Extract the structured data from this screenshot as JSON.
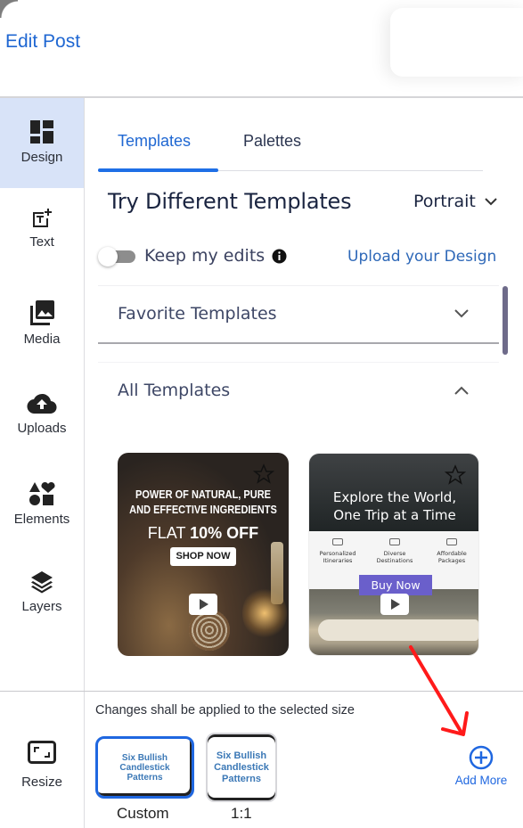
{
  "header": {
    "title": "Edit Post"
  },
  "sidebar": {
    "items": [
      {
        "label": "Design",
        "icon": "design-grid-icon",
        "active": true
      },
      {
        "label": "Text",
        "icon": "text-add-icon"
      },
      {
        "label": "Media",
        "icon": "media-icon"
      },
      {
        "label": "Uploads",
        "icon": "cloud-upload-icon"
      },
      {
        "label": "Elements",
        "icon": "shapes-icon"
      },
      {
        "label": "Layers",
        "icon": "layers-icon"
      }
    ],
    "resize": {
      "label": "Resize",
      "icon": "resize-icon"
    }
  },
  "tabs": [
    {
      "label": "Templates",
      "active": true
    },
    {
      "label": "Palettes",
      "active": false
    }
  ],
  "templates_panel": {
    "title": "Try Different Templates",
    "orientation": "Portrait",
    "keep_edits": {
      "label": "Keep my edits",
      "enabled": false
    },
    "upload_link": "Upload your Design",
    "sections": [
      {
        "title": "Favorite Templates",
        "expanded": false
      },
      {
        "title": "All Templates",
        "expanded": true
      }
    ],
    "cards": [
      {
        "headline_line1": "POWER OF NATURAL, PURE",
        "headline_line2": "AND EFFECTIVE INGREDIENTS",
        "offer_prefix": "FLAT ",
        "offer_bold": "10% OFF",
        "button": "SHOP NOW",
        "favorite": false
      },
      {
        "headline_line1": "Explore the World,",
        "headline_line2": "One Trip at a Time",
        "features": [
          {
            "line1": "Personalized",
            "line2": "Itineraries"
          },
          {
            "line1": "Diverse",
            "line2": "Destinations"
          },
          {
            "line1": "Affordable",
            "line2": "Packages"
          }
        ],
        "button": "Buy Now",
        "favorite": false
      }
    ]
  },
  "sizes": {
    "note": "Changes shall be applied to the selected size",
    "items": [
      {
        "label": "Custom",
        "preview_line1": "Six Bullish",
        "preview_line2": "Candlestick",
        "preview_line3": "Patterns",
        "selected": true
      },
      {
        "label": "1:1",
        "preview_line1": "Six Bullish",
        "preview_line2": "Candlestick",
        "preview_line3": "Patterns",
        "selected": false
      }
    ],
    "add_more": "Add More"
  },
  "colors": {
    "accent": "#1f67d2",
    "active_sidebar_bg": "#d8e3f8",
    "buy_now": "#6a5fcb",
    "annotation_arrow": "#ff0000"
  }
}
